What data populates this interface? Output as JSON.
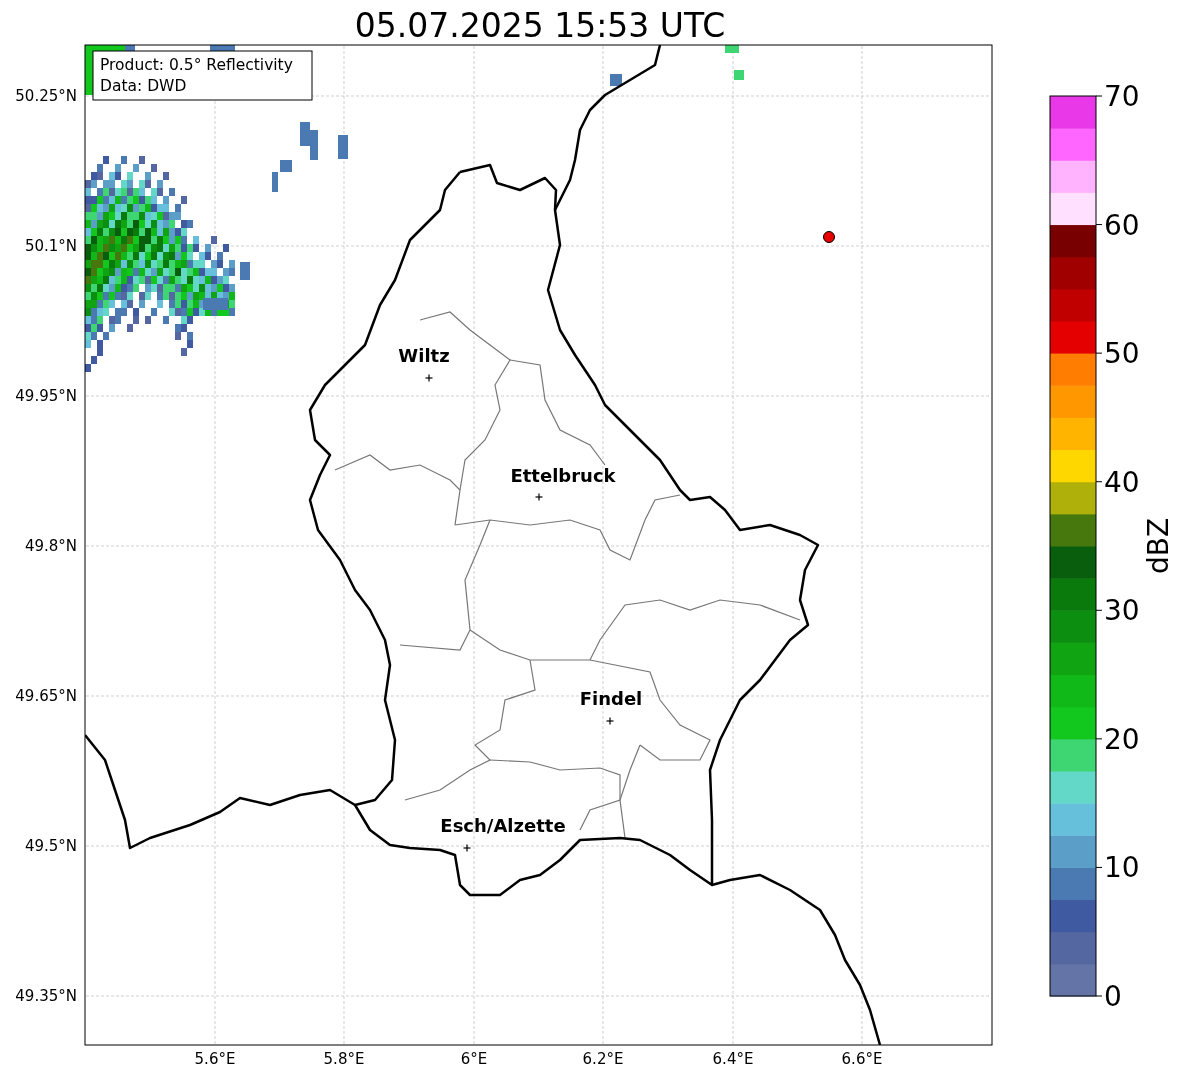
{
  "title": "05.07.2025 15:53 UTC",
  "info_box": [
    "Product: 0.5° Reflectivity",
    "Data: DWD"
  ],
  "lat_ticks": [
    "50.25°N",
    "50.1°N",
    "49.95°N",
    "49.8°N",
    "49.65°N",
    "49.5°N",
    "49.35°N"
  ],
  "lon_ticks": [
    "5.6°E",
    "5.8°E",
    "6°E",
    "6.2°E",
    "6.4°E",
    "6.6°E"
  ],
  "cities": [
    {
      "name": "Wiltz"
    },
    {
      "name": "Ettelbruck"
    },
    {
      "name": "Findel"
    },
    {
      "name": "Esch/Alzette"
    }
  ],
  "colorbar": {
    "label": "dBZ",
    "ticks": [
      "70",
      "60",
      "50",
      "40",
      "30",
      "20",
      "10",
      "0"
    ]
  }
}
